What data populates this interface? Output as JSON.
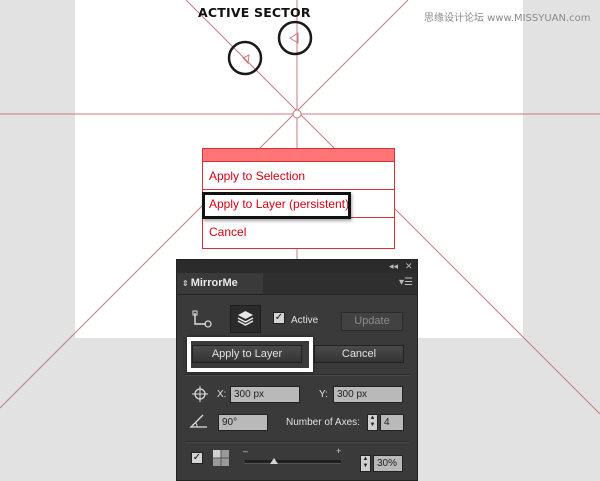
{
  "annotation": {
    "caption": "ACTIVE SECTOR"
  },
  "watermark": "思缘设计论坛 www.MISSYUAN.com",
  "context_menu": {
    "items": [
      "Apply to Selection",
      "Apply to Layer (persistent)",
      "Cancel"
    ],
    "highlighted_item": "Apply to Layer (persistent)"
  },
  "panel": {
    "tab_title": "MirrorMe",
    "active_label": "Active",
    "active_checked": true,
    "update_button": "Update",
    "apply_button": "Apply to Layer",
    "cancel_button": "Cancel",
    "x_label": "X:",
    "x_value": "300 px",
    "y_label": "Y:",
    "y_value": "300 px",
    "angle_value": "90°",
    "axes_label": "Number of Axes:",
    "axes_value": "4",
    "slider_min": "–",
    "slider_max": "+",
    "zoom_value": "30%"
  },
  "colors": {
    "guide": "#c97b80",
    "menu_text": "#d40012",
    "menu_border": "#d8303a",
    "menu_header": "#ff7575",
    "panel_bg": "#3a3a3a"
  }
}
